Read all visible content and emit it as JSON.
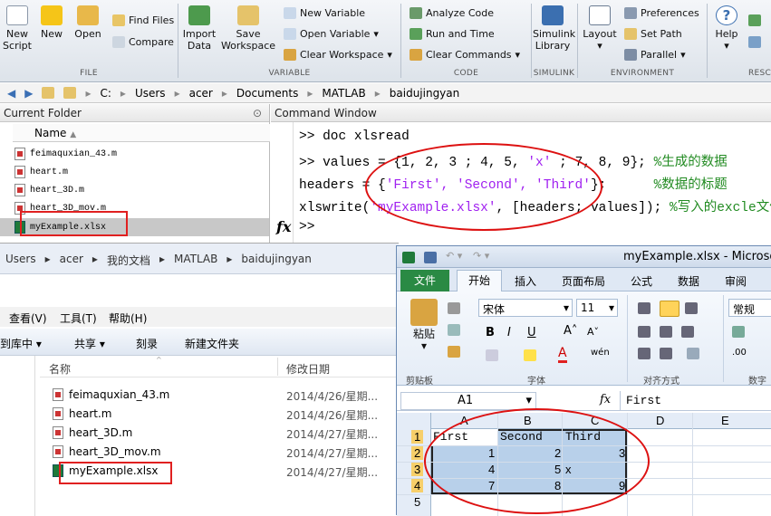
{
  "ribbon": {
    "file_group": {
      "label": "FILE",
      "new_script": "New\nScript",
      "new": "New",
      "open": "Open",
      "find_files": "Find Files",
      "compare": "Compare"
    },
    "variable_group": {
      "label": "VARIABLE",
      "import_data": "Import\nData",
      "save_workspace": "Save\nWorkspace",
      "new_variable": "New Variable",
      "open_variable": "Open Variable",
      "clear_workspace": "Clear Workspace"
    },
    "code_group": {
      "label": "CODE",
      "analyze_code": "Analyze Code",
      "run_and_time": "Run and Time",
      "clear_commands": "Clear Commands"
    },
    "simulink_group": {
      "label": "SIMULINK",
      "simulink_library": "Simulink\nLibrary"
    },
    "environment_group": {
      "label": "ENVIRONMENT",
      "layout": "Layout",
      "preferences": "Preferences",
      "set_path": "Set Path",
      "parallel": "Parallel"
    },
    "resources_group": {
      "label": "RESC",
      "help": "Help"
    }
  },
  "address_bar": {
    "path": [
      "C:",
      "Users",
      "acer",
      "Documents",
      "MATLAB",
      "baidujingyan"
    ]
  },
  "current_folder": {
    "title": "Current Folder",
    "column_name": "Name",
    "files": [
      "feimaquxian_43.m",
      "heart.m",
      "heart_3D.m",
      "heart_3D_mov.m",
      "myExample.xlsx"
    ]
  },
  "command_window": {
    "title": "Command Window",
    "prompt": ">>",
    "line1": "doc xlsread",
    "line2_code": "values = {1, 2, 3 ; 4, 5, ",
    "line2_str": "'x'",
    "line2_rest": " ; 7, 8, 9};",
    "line2_comment": "%生成的数据",
    "line3_code": "headers = {",
    "line3_strs": "'First', 'Second', 'Third'",
    "line3_rest": "};",
    "line3_comment": "%数据的标题",
    "line4_code": "xlswrite(",
    "line4_str": "'myExample.xlsx'",
    "line4_rest": ", [headers; values]);",
    "line4_comment": "%写入的excle文件名",
    "fx": "fx",
    "last_prompt": ">>"
  },
  "explorer": {
    "breadcrumb": [
      "Users",
      "acer",
      "我的文档",
      "MATLAB",
      "baidujingyan"
    ],
    "menu": [
      "查看(V)",
      "工具(T)",
      "帮助(H)"
    ],
    "toolbar": [
      "到库中",
      "共享",
      "刻录",
      "新建文件夹"
    ],
    "col_name": "名称",
    "col_date": "修改日期",
    "files": [
      {
        "name": "feimaquxian_43.m",
        "date": "2014/4/26/星期..."
      },
      {
        "name": "heart.m",
        "date": "2014/4/26/星期..."
      },
      {
        "name": "heart_3D.m",
        "date": "2014/4/27/星期..."
      },
      {
        "name": "heart_3D_mov.m",
        "date": "2014/4/27/星期..."
      },
      {
        "name": "myExample.xlsx",
        "date": "2014/4/27/星期..."
      }
    ]
  },
  "excel": {
    "title": "myExample.xlsx - Microsoft",
    "tabs": [
      "文件",
      "开始",
      "插入",
      "页面布局",
      "公式",
      "数据",
      "审阅"
    ],
    "font_name": "宋体",
    "font_size": "11",
    "number_format": "常规",
    "paste": "粘贴",
    "group_clipboard": "剪贴板",
    "group_font": "字体",
    "group_align": "对齐方式",
    "group_number": "数字",
    "name_box": "A1",
    "formula_fx": "fx",
    "formula_value": "First",
    "columns": [
      "A",
      "B",
      "C",
      "D",
      "E"
    ],
    "rows": [
      "1",
      "2",
      "3",
      "4",
      "5"
    ],
    "cells": {
      "a1": "First",
      "b1": "Second",
      "c1": "Third",
      "a2": "1",
      "b2": "2",
      "c2": "3",
      "a3": "4",
      "b3": "5",
      "c3": "x",
      "a4": "7",
      "b4": "8",
      "c4": "9"
    }
  },
  "colors": {
    "accent_red": "#e02020",
    "excel_green": "#217346",
    "selection": "#b8d0ea"
  }
}
